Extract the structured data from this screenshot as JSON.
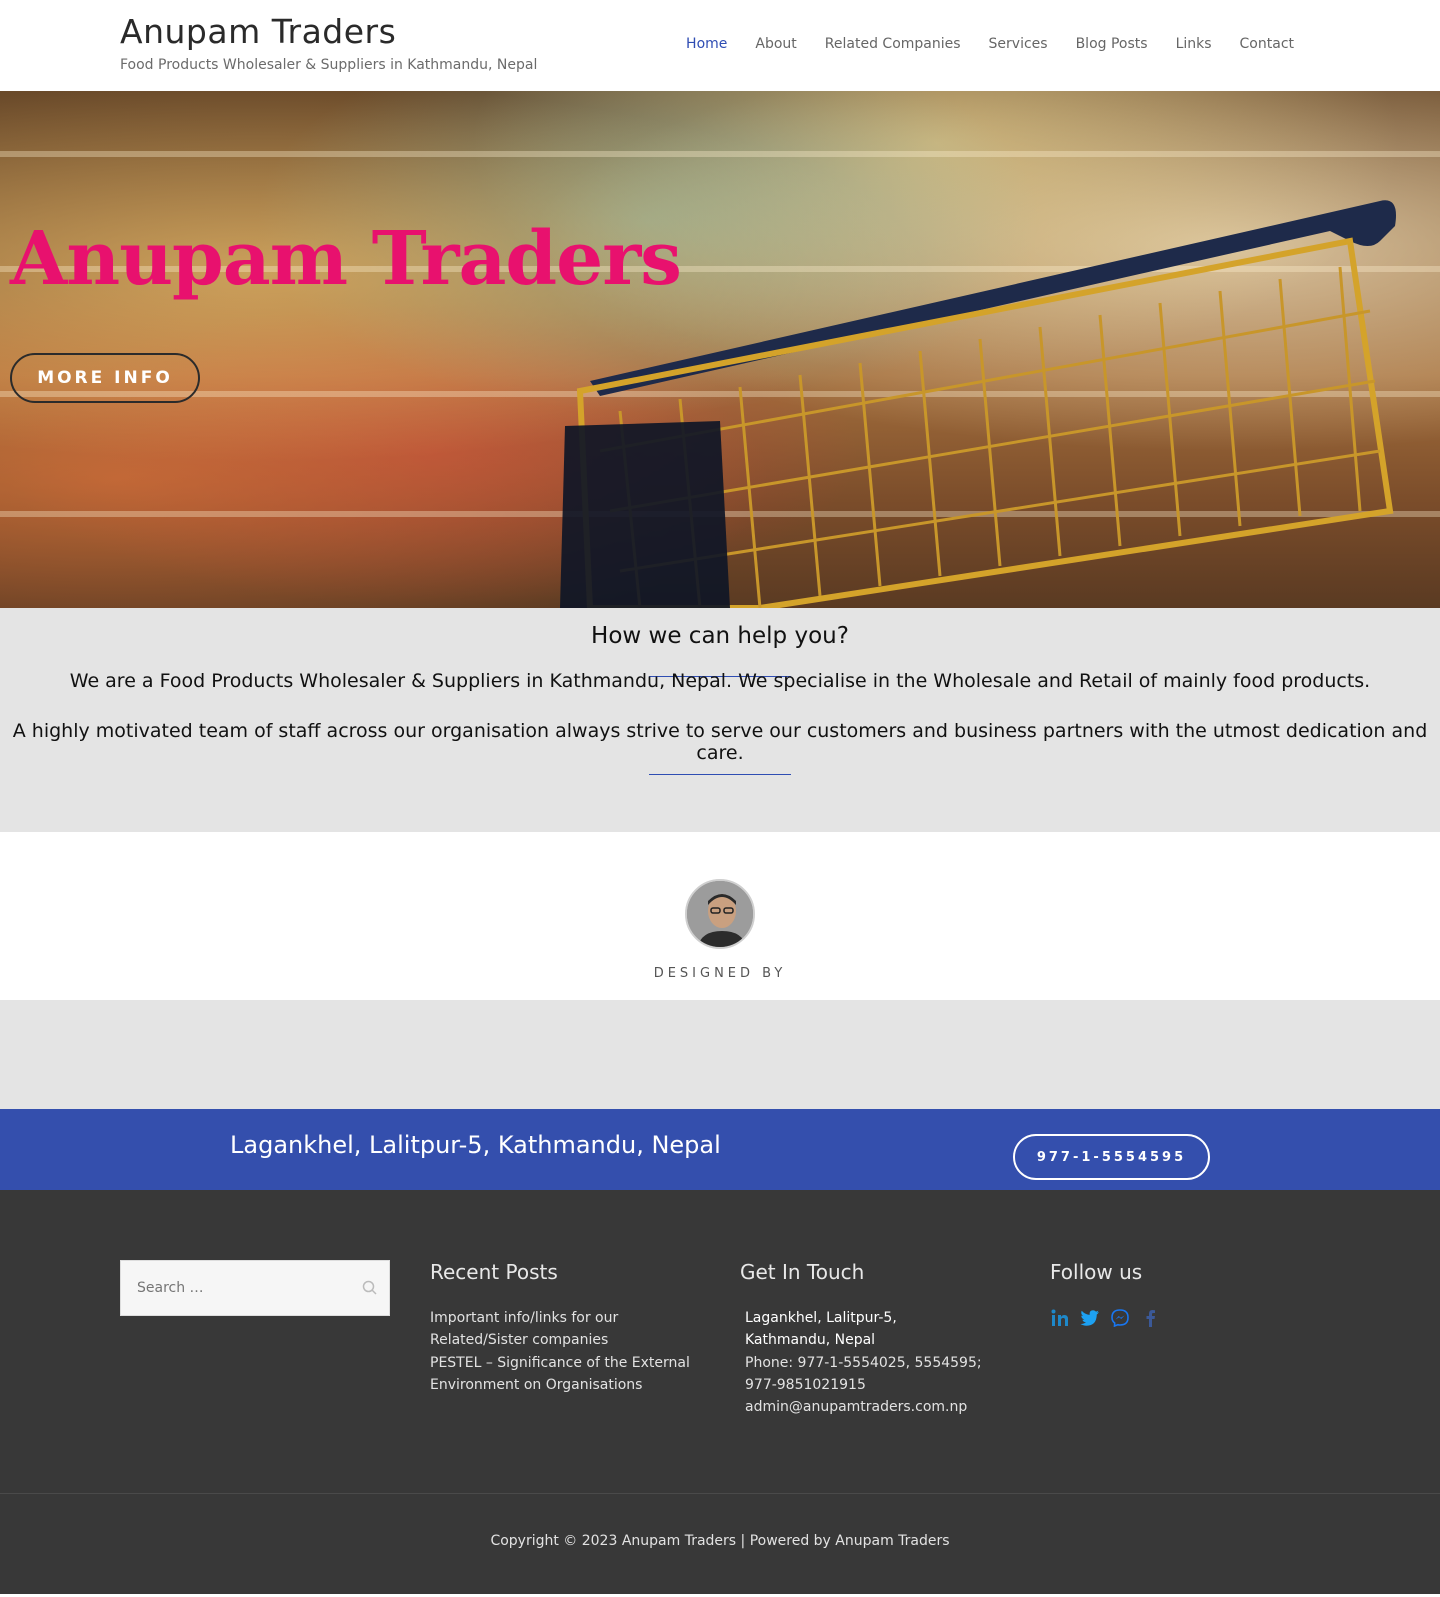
{
  "header": {
    "site_title": "Anupam Traders",
    "tagline": "Food Products Wholesaler & Suppliers in Kathmandu, Nepal",
    "nav": [
      {
        "label": "Home",
        "active": true
      },
      {
        "label": "About"
      },
      {
        "label": "Related Companies"
      },
      {
        "label": "Services"
      },
      {
        "label": "Blog Posts"
      },
      {
        "label": "Links"
      },
      {
        "label": "Contact"
      }
    ]
  },
  "hero": {
    "title": "Anupam Traders",
    "button_label": "MORE INFO"
  },
  "help": {
    "heading": "How we can help you?",
    "paragraph_1": "We are a Food Products Wholesaler & Suppliers in Kathmandu, Nepal. We specialise in the Wholesale and Retail of mainly food products.",
    "paragraph_2": "A highly motivated team of staff across our organisation always strive to serve our customers and business partners with the utmost dedication and care."
  },
  "designed": {
    "label": "DESIGNED BY"
  },
  "cta": {
    "address": "Lagankhel, Lalitpur-5, Kathmandu, Nepal",
    "phone_button": "977-1-5554595"
  },
  "footer": {
    "search_placeholder": "Search …",
    "recent_posts_title": "Recent Posts",
    "recent_posts": [
      {
        "line1": "Important info/links for our",
        "line2": "Related/Sister companies"
      },
      {
        "line1": "PESTEL – Significance of the External",
        "line2": "Environment on Organisations"
      }
    ],
    "get_in_touch_title": "Get In Touch",
    "contact_lines": [
      "Lagankhel, Lalitpur-5,",
      "Kathmandu, Nepal",
      "Phone: 977-1-5554025, 5554595;",
      "977-9851021915",
      "admin@anupamtraders.com.np"
    ],
    "follow_title": "Follow us",
    "social_icons": [
      "linkedin-icon",
      "twitter-icon",
      "messenger-icon",
      "facebook-icon"
    ],
    "copyright": "Copyright © 2023 Anupam Traders | Powered by Anupam Traders"
  },
  "colors": {
    "accent_blue": "#344fad",
    "hero_title_pink": "#e8116e",
    "footer_bg": "#383838",
    "section_grey": "#e4e4e4"
  }
}
